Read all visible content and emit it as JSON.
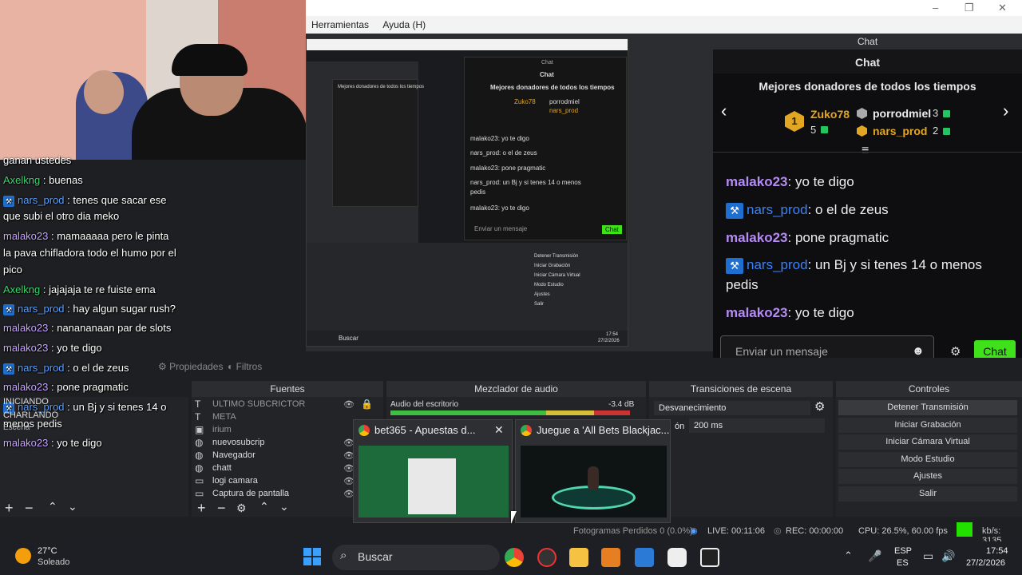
{
  "window": {
    "menu": [
      "Herramientas",
      "Ayuda (H)"
    ],
    "controls": [
      "–",
      "❐",
      "✕"
    ]
  },
  "chat": {
    "header": "Chat",
    "title": "Chat",
    "donors_title": "Mejores donadores de todos los tiempos",
    "donors": [
      {
        "rank": "1",
        "name": "Zuko78",
        "count": "5"
      },
      {
        "name": "porrodmiel",
        "count": "3"
      },
      {
        "name": "nars_prod",
        "count": "2"
      }
    ],
    "messages": [
      {
        "user": "malako23",
        "text": ": yo te digo",
        "style": "purple"
      },
      {
        "user": "nars_prod",
        "text": ": o el de zeus",
        "style": "blue"
      },
      {
        "user": "malako23",
        "text": ": pone pragmatic",
        "style": "purple"
      },
      {
        "user": "nars_prod",
        "text": ": un Bj y si tenes 14 o menos pedis",
        "style": "blue"
      },
      {
        "user": "malako23",
        "text": ": yo te digo",
        "style": "purple"
      }
    ],
    "input_placeholder": "Enviar un mensaje",
    "send_label": "Chat"
  },
  "overlay_chat": [
    {
      "user": "",
      "text": "ganan ustedes"
    },
    {
      "user": "Axelkng",
      "text": " : buenas",
      "style": "u2"
    },
    {
      "user": "nars_prod",
      "text": " : tenes que sacar ese",
      "style": "u3"
    },
    {
      "user": "",
      "text": "que subi el otro dia meko"
    },
    {
      "user": "malako23",
      "text": " : mamaaaaa pero le pinta",
      "style": "u1"
    },
    {
      "user": "",
      "text": "la pava chifladora todo el humo por el"
    },
    {
      "user": "",
      "text": "pico"
    },
    {
      "user": "Axelkng",
      "text": " : jajajaja te re fuiste ema",
      "style": "u2"
    },
    {
      "user": "nars_prod",
      "text": " : hay algun sugar rush?",
      "style": "u3"
    },
    {
      "user": "malako23",
      "text": " : nanananaan par de slots",
      "style": "u1"
    },
    {
      "user": "malako23",
      "text": " : yo te digo",
      "style": "u1"
    },
    {
      "user": "nars_prod",
      "text": " : o el de zeus",
      "style": "u3"
    },
    {
      "user": "malako23",
      "text": " : pone pragmatic",
      "style": "u1"
    },
    {
      "user": "nars_prod",
      "text": " : un Bj y si tenes 14 o",
      "style": "u3"
    },
    {
      "user": "",
      "text": "menos pedis"
    },
    {
      "user": "malako23",
      "text": " : yo te digo",
      "style": "u1"
    }
  ],
  "overlay_extra": [
    "INICIANDO",
    "CHARLANDO",
    "Escena"
  ],
  "toolbar": {
    "properties": "Propiedades",
    "filters": "Filtros"
  },
  "docks": {
    "sources_title": "Fuentes",
    "mixer_title": "Mezclador de audio",
    "transitions_title": "Transiciones de escena",
    "controls_title": "Controles"
  },
  "sources": [
    "ULTIMO SUBCRICTOR",
    "META",
    "irium",
    "nuevosubcrip",
    "Navegador",
    "chatt",
    "logi camara",
    "Captura de pantalla"
  ],
  "mixer": {
    "track": "Audio del escritorio",
    "level": "-3.4 dB"
  },
  "transitions": {
    "type": "Desvanecimiento",
    "duration_label": "ón",
    "duration": "200 ms"
  },
  "controls": [
    "Detener Transmisión",
    "Iniciar Grabación",
    "Iniciar Cámara Virtual",
    "Modo Estudio",
    "Ajustes",
    "Salir"
  ],
  "thumbs": [
    {
      "title": "bet365 - Apuestas d...",
      "close": "✕"
    },
    {
      "title": "Juegue a 'All Bets Blackjac..."
    }
  ],
  "status": {
    "dropped": "Fotogramas Perdidos 0 (0.0%)",
    "live": "LIVE: 00:11:06",
    "rec": "REC: 00:00:00",
    "cpu": "CPU: 26.5%, 60.00 fps",
    "kbs": "kb/s: 3135"
  },
  "taskbar": {
    "weather_temp": "27°C",
    "weather_desc": "Soleado",
    "search": "Buscar",
    "lang1": "ESP",
    "lang2": "ES",
    "time": "17:54",
    "date": "27/2/2026"
  },
  "nested": {
    "chat_header": "Chat",
    "chat_title": "Chat",
    "donors_title": "Mejores donadores de todos los tiempos",
    "d1": "Zuko78",
    "d2": "porrodmiel",
    "d3": "nars_prod",
    "msgs": [
      "malako23: yo te digo",
      "nars_prod: o el de zeus",
      "malako23: pone pragmatic",
      "nars_prod: un Bj y si tenes 14 o menos",
      "pedis",
      "malako23: yo te digo"
    ],
    "input": "Enviar un mensaje",
    "send": "Chat",
    "taskbar_search": "Buscar",
    "time": "17:54",
    "date": "27/2/2026",
    "controls": [
      "Detener Transmisión",
      "Iniciar Grabación",
      "Iniciar Cámara Virtual",
      "Modo Estudio",
      "Ajustes",
      "Salir"
    ]
  },
  "colors": {
    "accent_green": "#3fe11a",
    "username_purple": "#b58cf4",
    "username_blue": "#3b82f6",
    "donor_gold": "#e3a622"
  }
}
